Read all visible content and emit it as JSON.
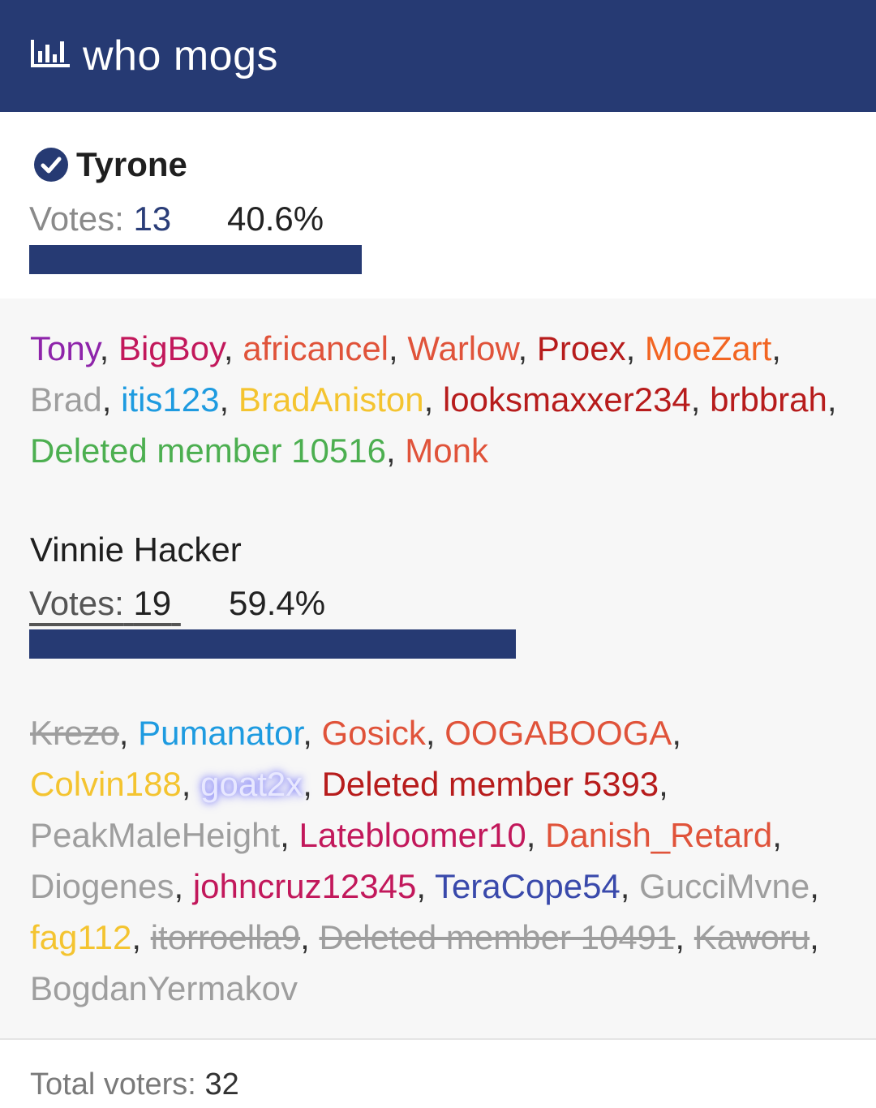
{
  "poll": {
    "title": "who mogs",
    "icon": "bar-chart-icon",
    "total_label": "Total voters:",
    "total_value": "32"
  },
  "options": [
    {
      "name": "Tyrone",
      "selected": true,
      "votes_label": "Votes:",
      "votes": "13",
      "percent": "40.6%",
      "fraction": 0.406,
      "voters": [
        {
          "name": "Tony",
          "color": "#8e24aa",
          "struck": false
        },
        {
          "name": "BigBoy",
          "color": "#c2185b",
          "struck": false
        },
        {
          "name": "africancel",
          "color": "#e0533a",
          "struck": false
        },
        {
          "name": "Warlow",
          "color": "#e0533a",
          "struck": false
        },
        {
          "name": "Proex",
          "color": "#b71c1c",
          "struck": false
        },
        {
          "name": "MoeZart",
          "color": "#f26522",
          "struck": false
        },
        {
          "name": "Brad",
          "color": "#9e9e9e",
          "struck": false
        },
        {
          "name": "itis123",
          "color": "#1e9be0",
          "struck": false
        },
        {
          "name": "BradAniston",
          "color": "#f4c430",
          "struck": false
        },
        {
          "name": "looksmaxxer234",
          "color": "#b71c1c",
          "struck": false
        },
        {
          "name": "brbbrah",
          "color": "#b71c1c",
          "struck": false
        },
        {
          "name": "Deleted member 10516",
          "color": "#4caf50",
          "struck": false
        },
        {
          "name": "Monk",
          "color": "#e0533a",
          "struck": false
        }
      ]
    },
    {
      "name": "Vinnie Hacker",
      "selected": false,
      "votes_label": "Votes:",
      "votes": "19",
      "percent": "59.4%",
      "fraction": 0.594,
      "voters": [
        {
          "name": "Krezo",
          "color": "#9e9e9e",
          "struck": true
        },
        {
          "name": "Pumanator",
          "color": "#1e9be0",
          "struck": false
        },
        {
          "name": "Gosick",
          "color": "#e0533a",
          "struck": false
        },
        {
          "name": "OOGABOOGA",
          "color": "#e0533a",
          "struck": false
        },
        {
          "name": "Colvin188",
          "color": "#f4c430",
          "struck": false
        },
        {
          "name": "goat2x",
          "color": "#e8e8ff",
          "struck": false,
          "glow": true
        },
        {
          "name": "Deleted member 5393",
          "color": "#b71c1c",
          "struck": false
        },
        {
          "name": "PeakMaleHeight",
          "color": "#9e9e9e",
          "struck": false
        },
        {
          "name": "Latebloomer10",
          "color": "#c2185b",
          "struck": false
        },
        {
          "name": "Danish_Retard",
          "color": "#e0533a",
          "struck": false
        },
        {
          "name": "Diogenes",
          "color": "#9e9e9e",
          "struck": false
        },
        {
          "name": "johncruz12345",
          "color": "#c2185b",
          "struck": false
        },
        {
          "name": "TeraCope54",
          "color": "#3949ab",
          "struck": false
        },
        {
          "name": "GucciMvne",
          "color": "#9e9e9e",
          "struck": false
        },
        {
          "name": "fag112",
          "color": "#f4c430",
          "struck": false
        },
        {
          "name": "itorroella9",
          "color": "#9e9e9e",
          "struck": true
        },
        {
          "name": "Deleted member 10491",
          "color": "#9e9e9e",
          "struck": true
        },
        {
          "name": "Kaworu",
          "color": "#9e9e9e",
          "struck": true
        },
        {
          "name": "BogdanYermakov",
          "color": "#9e9e9e",
          "struck": false
        }
      ]
    }
  ],
  "colors": {
    "header": "#263a73",
    "bar": "#263a73"
  }
}
